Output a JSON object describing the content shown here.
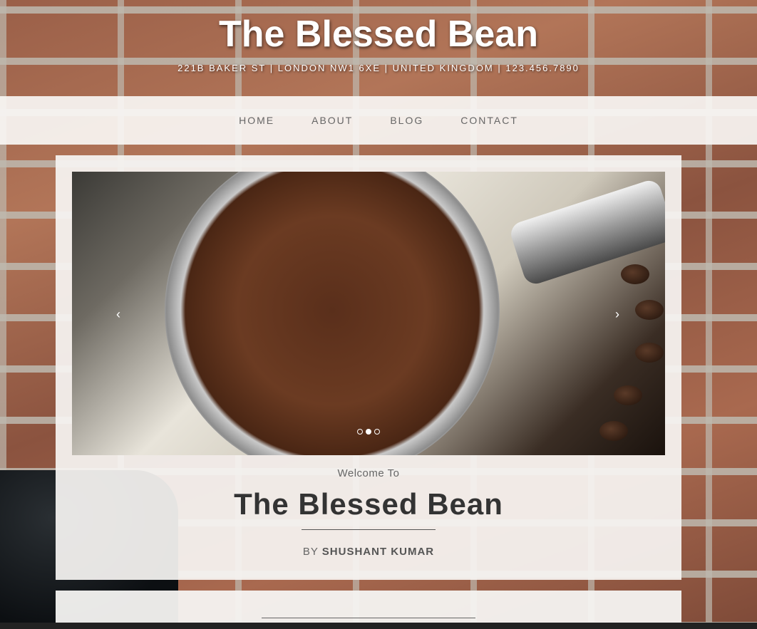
{
  "header": {
    "title": "The Blessed Bean",
    "address": "221B BAKER ST | LONDON NW1 6XE | UNITED KINGDOM | 123.456.7890"
  },
  "nav": {
    "items": [
      "HOME",
      "ABOUT",
      "BLOG",
      "CONTACT"
    ]
  },
  "slider": {
    "prev": "‹",
    "next": "›",
    "active_index": 1,
    "slide_count": 3
  },
  "intro": {
    "welcome": "Welcome To",
    "title": "The Blessed Bean",
    "by_prefix": "BY",
    "author": "SHUSHANT KUMAR"
  },
  "colors": {
    "title_text": "#ffffff",
    "nav_text": "#666666",
    "heading_text": "#333333"
  }
}
